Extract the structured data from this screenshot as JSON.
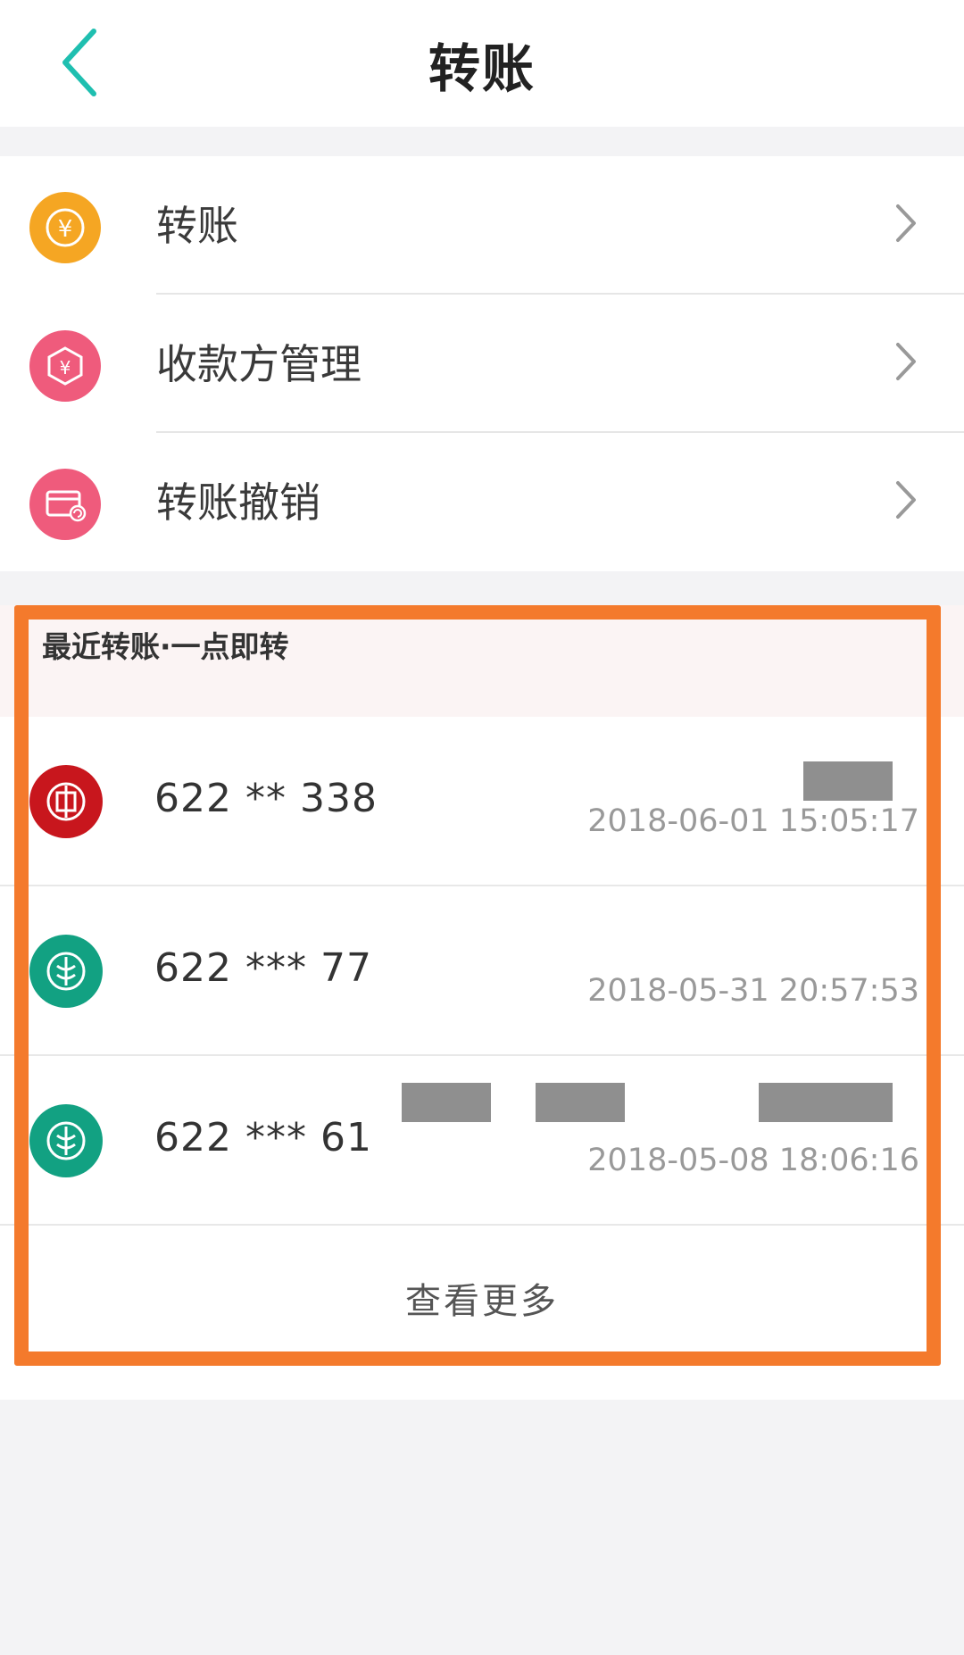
{
  "header": {
    "title": "转账"
  },
  "menu": {
    "items": [
      {
        "label": "转账",
        "icon": "yuan-transfer-icon",
        "color": "#f5a623"
      },
      {
        "label": "收款方管理",
        "icon": "payee-hexagon-icon",
        "color": "#ef5b7c"
      },
      {
        "label": "转账撤销",
        "icon": "card-undo-icon",
        "color": "#ef5b7c"
      }
    ]
  },
  "recent": {
    "title": "最近转账·一点即转",
    "records": [
      {
        "account": "622   **   338",
        "time": "2018-06-01 15:05:17",
        "bank_icon": "icbc-logo-icon",
        "bank_color": "#c8161d"
      },
      {
        "account": "622   ***   77",
        "time": "2018-05-31 20:57:53",
        "bank_icon": "abc-logo-icon",
        "bank_color": "#12a182"
      },
      {
        "account": "622   ***   61",
        "time": "2018-05-08 18:06:16",
        "bank_icon": "abc-logo-icon",
        "bank_color": "#12a182"
      }
    ],
    "more_label": "查看更多"
  },
  "colors": {
    "accent": "#1fbfb0",
    "highlight": "#f47a2c"
  }
}
